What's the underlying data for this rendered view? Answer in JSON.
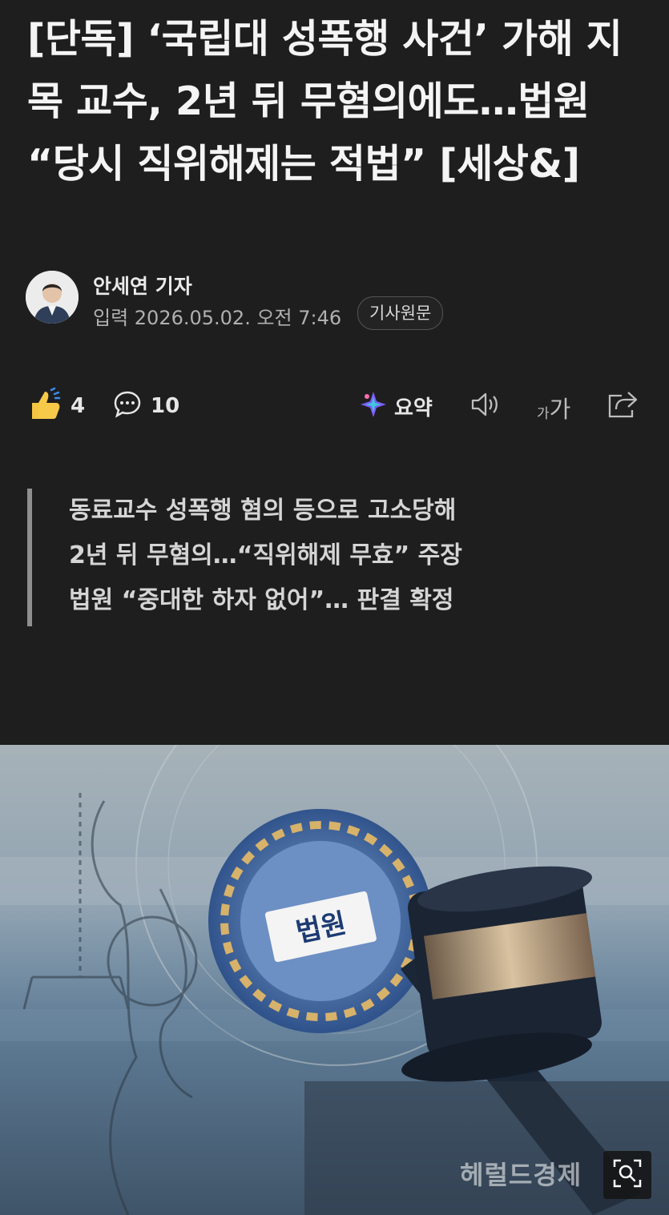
{
  "article": {
    "headline": "[단독] ‘국립대 성폭행 사건’ 가해 지목 교수, 2년 뒤 무혐의에도…법원 “당시 직위해제는 적법” [세상&]",
    "reporter": "안세연 기자",
    "published": "입력 2026.05.02. 오전 7:46",
    "original_button": "기사원문"
  },
  "toolbar": {
    "likes": "4",
    "comments": "10",
    "summary_label": "요약",
    "font_size_label_small": "가",
    "font_size_label_large": "가",
    "icons": [
      "thumbs-up-icon",
      "comment-icon",
      "ai-summary-icon",
      "speaker-icon",
      "font-size-icon",
      "share-icon"
    ]
  },
  "summary_lines": [
    "동료교수 성폭행 혐의 등으로 고소당해",
    "2년 뒤 무혐의…“직위해제 무효” 주장",
    "법원 “중대한 하자 없어”… 판결 확정"
  ],
  "photo": {
    "court_sign": "법원",
    "watermark": "헤럴드경제"
  },
  "colors": {
    "background": "#1e1e1f",
    "text": "#f2f2f2",
    "summary_bar": "#8f8f8f"
  }
}
